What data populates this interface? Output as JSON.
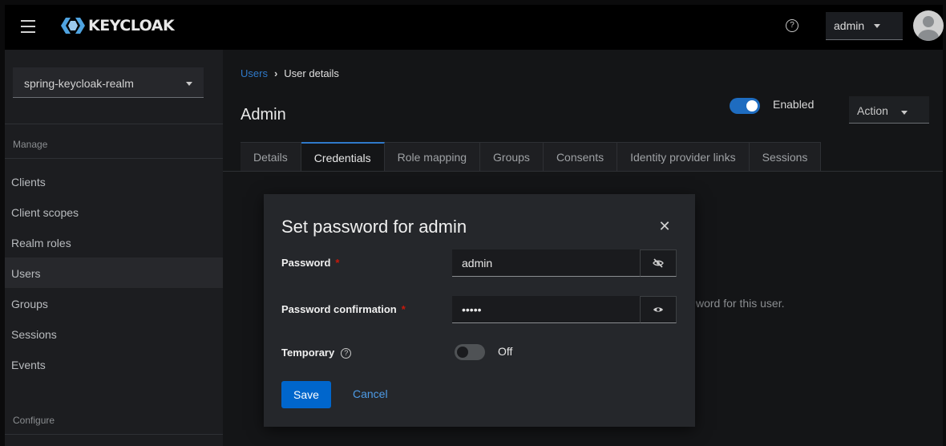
{
  "header": {
    "logo_text": "KEYCLOAK",
    "user_menu": "admin"
  },
  "sidebar": {
    "realm": "spring-keycloak-realm",
    "manage_label": "Manage",
    "items": [
      "Clients",
      "Client scopes",
      "Realm roles",
      "Users",
      "Groups",
      "Sessions",
      "Events"
    ],
    "active_item": "Users",
    "configure_label": "Configure"
  },
  "main": {
    "breadcrumb": {
      "link": "Users",
      "current": "User details"
    },
    "title": "Admin",
    "enabled_label": "Enabled",
    "enabled": true,
    "action_label": "Action",
    "tabs": [
      "Details",
      "Credentials",
      "Role mapping",
      "Groups",
      "Consents",
      "Identity provider links",
      "Sessions"
    ],
    "active_tab": "Credentials",
    "behind_text": "word for this user."
  },
  "modal": {
    "title": "Set password for admin",
    "password_label": "Password",
    "password_value": "admin",
    "confirm_label": "Password confirmation",
    "confirm_value": "•••••",
    "temporary_label": "Temporary",
    "temporary_state": "Off",
    "save_label": "Save",
    "cancel_label": "Cancel"
  },
  "colors": {
    "primary": "#0066cc",
    "link": "#2f79c9",
    "required": "#c9190b"
  }
}
